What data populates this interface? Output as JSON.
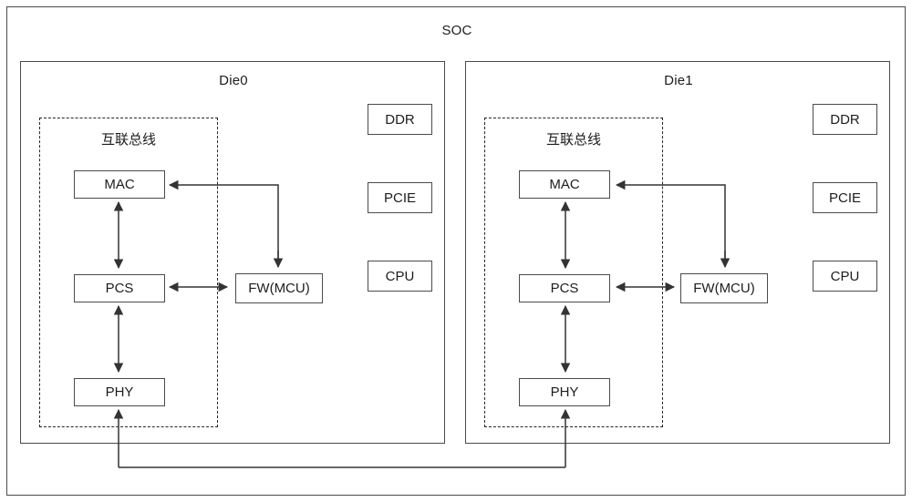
{
  "soc": {
    "title": "SOC"
  },
  "dies": [
    {
      "title": "Die0",
      "bus": {
        "label": "互联总线"
      },
      "pipeline": [
        {
          "label": "MAC"
        },
        {
          "label": "PCS"
        },
        {
          "label": "PHY"
        }
      ],
      "firmware": {
        "label": "FW(MCU)"
      },
      "peripherals": [
        {
          "label": "DDR"
        },
        {
          "label": "PCIE"
        },
        {
          "label": "CPU"
        }
      ]
    },
    {
      "title": "Die1",
      "bus": {
        "label": "互联总线"
      },
      "pipeline": [
        {
          "label": "MAC"
        },
        {
          "label": "PCS"
        },
        {
          "label": "PHY"
        }
      ],
      "firmware": {
        "label": "FW(MCU)"
      },
      "peripherals": [
        {
          "label": "DDR"
        },
        {
          "label": "PCIE"
        },
        {
          "label": "CPU"
        }
      ]
    }
  ],
  "connections": [
    {
      "name": "mac-pcs-link-die0",
      "kind": "bidirectional-vertical"
    },
    {
      "name": "pcs-phy-link-die0",
      "kind": "bidirectional-vertical"
    },
    {
      "name": "pcs-fw-link-die0",
      "kind": "bidirectional-horizontal"
    },
    {
      "name": "fw-mac-feedback-die0",
      "kind": "elbow-arrow-to-mac"
    },
    {
      "name": "mac-pcs-link-die1",
      "kind": "bidirectional-vertical"
    },
    {
      "name": "pcs-phy-link-die1",
      "kind": "bidirectional-vertical"
    },
    {
      "name": "pcs-fw-link-die1",
      "kind": "bidirectional-horizontal"
    },
    {
      "name": "fw-mac-feedback-die1",
      "kind": "elbow-arrow-to-mac"
    },
    {
      "name": "phy-to-phy-interdie-link",
      "kind": "u-shaped-double-arrow"
    }
  ],
  "colors": {
    "frame_stroke": "#4b4b4b",
    "wire_stroke": "#333333",
    "dashed_stroke": "#262626",
    "text": "#1d1d1d",
    "background": "#ffffff"
  }
}
